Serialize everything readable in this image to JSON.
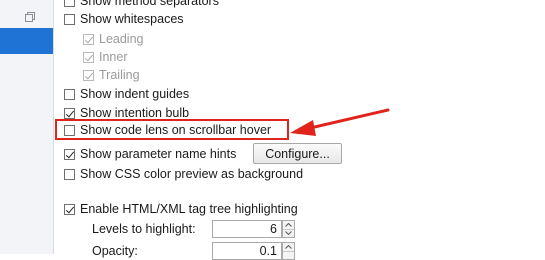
{
  "options": [
    {
      "label": "Show method separators",
      "checked": false
    },
    {
      "label": "Show whitespaces",
      "checked": false
    },
    {
      "label": "Leading",
      "checked": true,
      "disabled": true
    },
    {
      "label": "Inner",
      "checked": true,
      "disabled": true
    },
    {
      "label": "Trailing",
      "checked": true,
      "disabled": true
    },
    {
      "label": "Show indent guides",
      "checked": false
    },
    {
      "label": "Show intention bulb",
      "checked": true
    },
    {
      "label": "Show code lens on scrollbar hover",
      "checked": false
    },
    {
      "label": "Show parameter name hints",
      "checked": true
    },
    {
      "label": "Show CSS color preview as background",
      "checked": false
    },
    {
      "label": "Enable HTML/XML tag tree highlighting",
      "checked": true
    }
  ],
  "configure_label": "Configure...",
  "levels": {
    "label": "Levels to highlight:",
    "value": "6"
  },
  "opacity": {
    "label": "Opacity:",
    "value": "0.1"
  },
  "colors": {
    "annotation": "#e0241b",
    "sidebar_selected": "#1f73d4"
  }
}
